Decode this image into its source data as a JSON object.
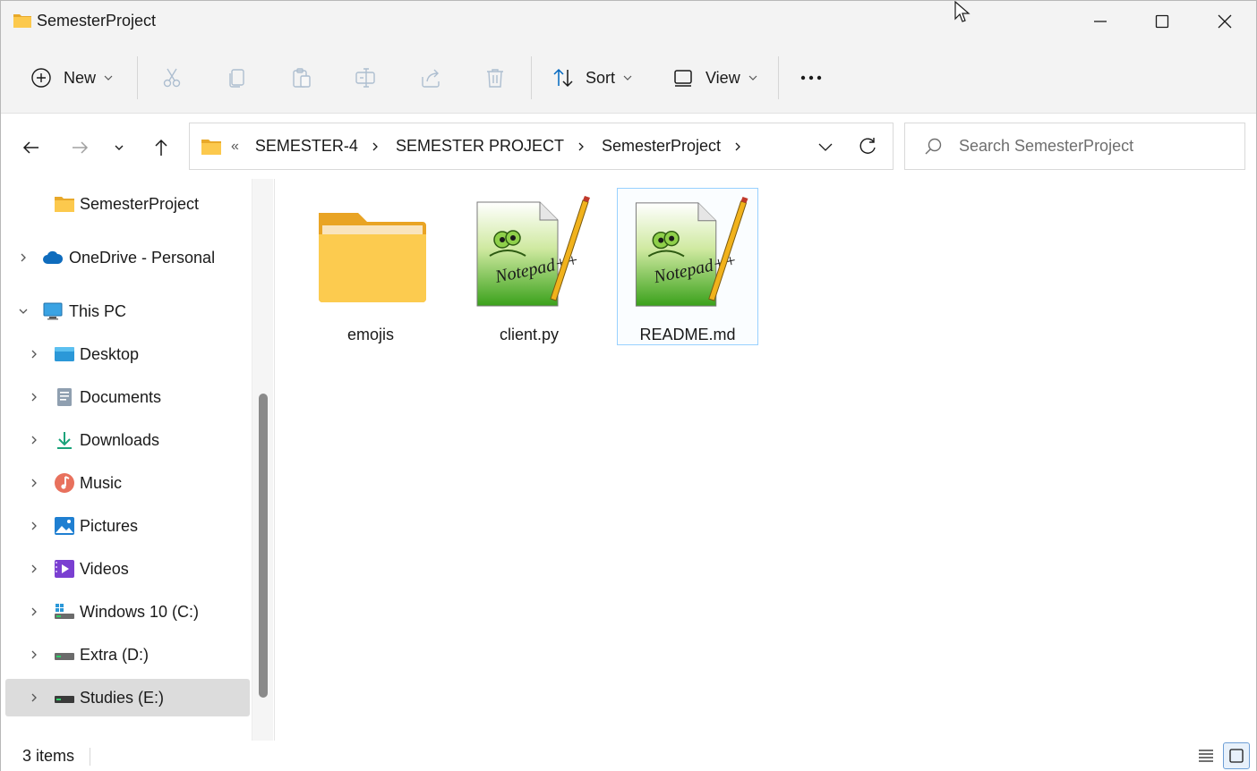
{
  "window": {
    "title": "SemesterProject",
    "controls": [
      "minimize",
      "maximize",
      "close"
    ]
  },
  "commandbar": {
    "new_label": "New",
    "sort_label": "Sort",
    "view_label": "View",
    "icons": [
      "cut-icon",
      "copy-icon",
      "paste-icon",
      "rename-icon",
      "share-icon",
      "delete-icon"
    ]
  },
  "address": {
    "overflow": "«",
    "crumbs": [
      "SEMESTER-4",
      "SEMESTER PROJECT",
      "SemesterProject"
    ]
  },
  "search": {
    "placeholder": "Search SemesterProject"
  },
  "nav": {
    "items": [
      {
        "label": "SemesterProject",
        "icon": "folder-icon"
      },
      {
        "label": "OneDrive - Personal",
        "icon": "cloud-icon"
      },
      {
        "label": "This PC",
        "icon": "monitor-icon"
      },
      {
        "label": "Desktop",
        "icon": "desktop-icon"
      },
      {
        "label": "Documents",
        "icon": "documents-icon"
      },
      {
        "label": "Downloads",
        "icon": "download-icon"
      },
      {
        "label": "Music",
        "icon": "music-icon"
      },
      {
        "label": "Pictures",
        "icon": "pictures-icon"
      },
      {
        "label": "Videos",
        "icon": "videos-icon"
      },
      {
        "label": "Windows 10 (C:)",
        "icon": "windows-drive-icon"
      },
      {
        "label": "Extra (D:)",
        "icon": "drive-icon"
      },
      {
        "label": "Studies (E:)",
        "icon": "drive-icon"
      }
    ]
  },
  "files": [
    {
      "name": "emojis",
      "type": "folder"
    },
    {
      "name": "client.py",
      "type": "notepadpp-file"
    },
    {
      "name": "README.md",
      "type": "notepadpp-file"
    }
  ],
  "status": {
    "count": "3 items"
  },
  "colors": {
    "accent": "#0067c0",
    "folder": "#f8c84a",
    "selection_border": "#99d1ff"
  }
}
